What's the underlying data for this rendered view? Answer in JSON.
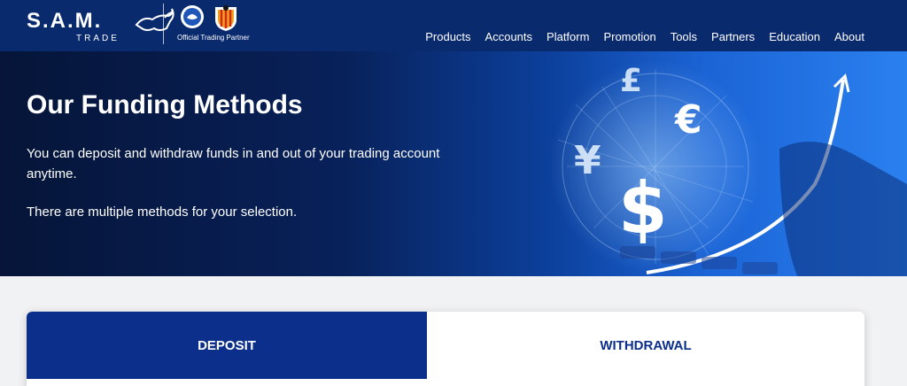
{
  "brand": {
    "name": "S.A.M.",
    "sub": "TRADE"
  },
  "partner": {
    "text": "Official Trading Partner"
  },
  "nav": [
    "Products",
    "Accounts",
    "Platform",
    "Promotion",
    "Tools",
    "Partners",
    "Education",
    "About"
  ],
  "hero": {
    "title": "Our Funding Methods",
    "p1": "You can deposit and withdraw funds in and out of your trading account anytime.",
    "p2": "There are multiple methods for your selection."
  },
  "tabs": {
    "deposit": "DEPOSIT",
    "withdrawal": "WITHDRAWAL",
    "active": "deposit"
  },
  "colors": {
    "header": "#0a2a6e",
    "accent": "#0b2f8a",
    "page_bg": "#f1f2f4"
  }
}
